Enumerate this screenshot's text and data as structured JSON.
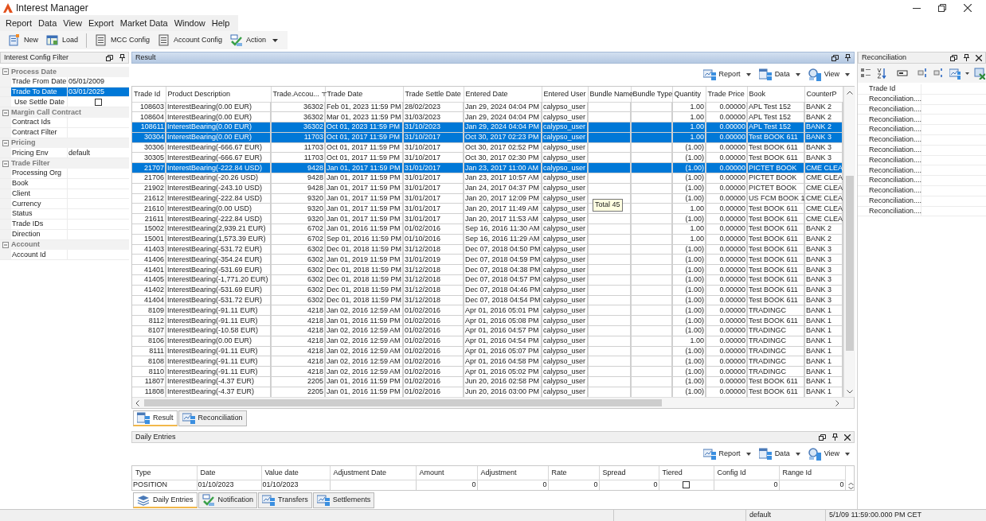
{
  "window": {
    "title": "Interest Manager"
  },
  "menu": [
    "Report",
    "Data",
    "View",
    "Export",
    "Market Data",
    "Window",
    "Help"
  ],
  "toolbar": [
    {
      "label": "New",
      "kind": "button"
    },
    {
      "label": "Load",
      "kind": "button"
    },
    {
      "label": "MCC Config",
      "kind": "button"
    },
    {
      "label": "Account Config",
      "kind": "button"
    },
    {
      "label": "Action",
      "kind": "dropdown"
    }
  ],
  "filter_panel": {
    "title": "Interest Config Filter",
    "groups": [
      {
        "title": "Process Date",
        "expanded": true,
        "fields": [
          {
            "label": "Trade From Date",
            "value": "05/01/2009",
            "kind": "text",
            "selected": false
          },
          {
            "label": "Trade To Date",
            "value": "03/01/2025",
            "kind": "text",
            "selected": true
          },
          {
            "label": "Use Settle Date",
            "kind": "checkbox",
            "checked": false,
            "selected": false
          }
        ]
      },
      {
        "title": "Margin Call Contract",
        "expanded": true,
        "fields": [
          {
            "label": "Contract Ids",
            "kind": "text",
            "selected": false
          },
          {
            "label": "Contract Filter",
            "kind": "text",
            "selected": false
          }
        ]
      },
      {
        "title": "Pricing",
        "expanded": true,
        "fields": [
          {
            "label": "Pricing Env",
            "value": "default",
            "kind": "text",
            "selected": false
          }
        ]
      },
      {
        "title": "Trade Filter",
        "expanded": true,
        "fields": [
          {
            "label": "Processing Org",
            "kind": "text",
            "selected": false
          },
          {
            "label": "Book",
            "kind": "text",
            "selected": false
          },
          {
            "label": "Client",
            "kind": "text",
            "selected": false
          },
          {
            "label": "Currency",
            "kind": "text",
            "selected": false
          },
          {
            "label": "Status",
            "kind": "text",
            "selected": false
          },
          {
            "label": "Trade IDs",
            "kind": "text",
            "selected": false
          },
          {
            "label": "Direction",
            "kind": "text",
            "selected": false
          }
        ]
      },
      {
        "title": "Account",
        "expanded": true,
        "fields": [
          {
            "label": "Account Id",
            "kind": "text",
            "selected": false
          }
        ]
      }
    ]
  },
  "result_panel": {
    "title": "Result",
    "actions": [
      "Report",
      "Data",
      "View"
    ],
    "table": {
      "columns": [
        {
          "label": "Trade Id",
          "kind": "number"
        },
        {
          "label": "Product Description",
          "kind": "text"
        },
        {
          "label": "Trade.Accou...",
          "kind": "number",
          "sorted": true
        },
        {
          "label": "Trade Date",
          "kind": "text"
        },
        {
          "label": "Trade Settle Date",
          "kind": "text"
        },
        {
          "label": "Entered Date",
          "kind": "text"
        },
        {
          "label": "Entered User",
          "kind": "text"
        },
        {
          "label": "Bundle Name",
          "kind": "text"
        },
        {
          "label": "Bundle Type",
          "kind": "text"
        },
        {
          "label": "Quantity",
          "kind": "number"
        },
        {
          "label": "Trade Price",
          "kind": "number"
        },
        {
          "label": "Book",
          "kind": "text"
        },
        {
          "label": "CounterP",
          "kind": "text"
        }
      ],
      "rows": [
        {
          "cells": [
            "108603",
            "InterestBearing(0.00 EUR)",
            "36302",
            "Feb 01, 2023 11:59 PM",
            "28/02/2023",
            "Jan 29, 2024 04:04 PM",
            "calypso_user",
            "",
            "",
            "1.00",
            "0.00000",
            "APL Test 152",
            "BANK 2"
          ],
          "selected": false
        },
        {
          "cells": [
            "108604",
            "InterestBearing(0.00 EUR)",
            "36302",
            "Mar 01, 2023 11:59 PM",
            "31/03/2023",
            "Jan 29, 2024 04:04 PM",
            "calypso_user",
            "",
            "",
            "1.00",
            "0.00000",
            "APL Test 152",
            "BANK 2"
          ],
          "selected": false
        },
        {
          "cells": [
            "108611",
            "InterestBearing(0.00 EUR)",
            "36302",
            "Oct 01, 2023 11:59 PM",
            "31/10/2023",
            "Jan 29, 2024 04:04 PM",
            "calypso_user",
            "",
            "",
            "1.00",
            "0.00000",
            "APL Test 152",
            "BANK 2"
          ],
          "selected": true
        },
        {
          "cells": [
            "30304",
            "InterestBearing(0.00 EUR)",
            "11703",
            "Oct 01, 2017 11:59 PM",
            "31/10/2017",
            "Oct 30, 2017 02:23 PM",
            "calypso_user",
            "",
            "",
            "1.00",
            "0.00000",
            "Test BOOK 611",
            "BANK 3"
          ],
          "selected": true
        },
        {
          "cells": [
            "30306",
            "InterestBearing(-666.67 EUR)",
            "11703",
            "Oct 01, 2017 11:59 PM",
            "31/10/2017",
            "Oct 30, 2017 02:52 PM",
            "calypso_user",
            "",
            "",
            "(1.00)",
            "0.00000",
            "Test BOOK 611",
            "BANK 3"
          ],
          "selected": false
        },
        {
          "cells": [
            "30305",
            "InterestBearing(-666.67 EUR)",
            "11703",
            "Oct 01, 2017 11:59 PM",
            "31/10/2017",
            "Oct 30, 2017 02:30 PM",
            "calypso_user",
            "",
            "",
            "(1.00)",
            "0.00000",
            "Test BOOK 611",
            "BANK 3"
          ],
          "selected": false
        },
        {
          "cells": [
            "21707",
            "InterestBearing(-222.84 USD)",
            "9428",
            "Jan 01, 2017 11:59 PM",
            "31/01/2017",
            "Jan 23, 2017 11:00 AM",
            "calypso_user",
            "",
            "",
            "(1.00)",
            "0.00000",
            "PICTET BOOK",
            "CME CLEA"
          ],
          "selected": true
        },
        {
          "cells": [
            "21706",
            "InterestBearing(-20.26 USD)",
            "9428",
            "Jan 01, 2017 11:59 PM",
            "31/01/2017",
            "Jan 23, 2017 10:57 AM",
            "calypso_user",
            "",
            "",
            "(1.00)",
            "0.00000",
            "PICTET BOOK",
            "CME CLEA"
          ],
          "selected": false
        },
        {
          "cells": [
            "21902",
            "InterestBearing(-243.10 USD)",
            "9428",
            "Jan 01, 2017 11:59 PM",
            "31/01/2017",
            "Jan 24, 2017 04:37 PM",
            "calypso_user",
            "",
            "",
            "(1.00)",
            "0.00000",
            "PICTET BOOK",
            "CME CLEA"
          ],
          "selected": false
        },
        {
          "cells": [
            "21612",
            "InterestBearing(-222.84 USD)",
            "9320",
            "Jan 01, 2017 11:59 PM",
            "31/01/2017",
            "Jan 20, 2017 12:09 PM",
            "calypso_user",
            "",
            "",
            "(1.00)",
            "0.00000",
            "US FCM BOOK 1",
            "CME CLEA"
          ],
          "selected": false
        },
        {
          "cells": [
            "21610",
            "InterestBearing(0.00 USD)",
            "9320",
            "Jan 01, 2017 11:59 PM",
            "31/01/2017",
            "Jan 20, 2017 11:49 AM",
            "calypso_user",
            "",
            "",
            "1.00",
            "0.00000",
            "Test BOOK 611",
            "CME CLEA"
          ],
          "selected": false
        },
        {
          "cells": [
            "21611",
            "InterestBearing(-222.84 USD)",
            "9320",
            "Jan 01, 2017 11:59 PM",
            "31/01/2017",
            "Jan 20, 2017 11:53 AM",
            "calypso_user",
            "",
            "",
            "(1.00)",
            "0.00000",
            "Test BOOK 611",
            "CME CLEA"
          ],
          "selected": false
        },
        {
          "cells": [
            "15002",
            "InterestBearing(2,939.21 EUR)",
            "6702",
            "Jan 01, 2016 11:59 PM",
            "01/02/2016",
            "Sep 16, 2016 11:30 AM",
            "calypso_user",
            "",
            "",
            "1.00",
            "0.00000",
            "Test BOOK 611",
            "BANK 2"
          ],
          "selected": false
        },
        {
          "cells": [
            "15001",
            "InterestBearing(1,573.39 EUR)",
            "6702",
            "Sep 01, 2016 11:59 PM",
            "01/10/2016",
            "Sep 16, 2016 11:29 AM",
            "calypso_user",
            "",
            "",
            "1.00",
            "0.00000",
            "Test BOOK 611",
            "BANK 2"
          ],
          "selected": false
        },
        {
          "cells": [
            "41403",
            "InterestBearing(-531.72 EUR)",
            "6302",
            "Dec 01, 2018 11:59 PM",
            "31/12/2018",
            "Dec 07, 2018 04:50 PM",
            "calypso_user",
            "",
            "",
            "(1.00)",
            "0.00000",
            "Test BOOK 611",
            "BANK 3"
          ],
          "selected": false
        },
        {
          "cells": [
            "41406",
            "InterestBearing(-354.24 EUR)",
            "6302",
            "Jan 01, 2019 11:59 PM",
            "31/01/2019",
            "Dec 07, 2018 04:59 PM",
            "calypso_user",
            "",
            "",
            "(1.00)",
            "0.00000",
            "Test BOOK 611",
            "BANK 3"
          ],
          "selected": false
        },
        {
          "cells": [
            "41401",
            "InterestBearing(-531.69 EUR)",
            "6302",
            "Dec 01, 2018 11:59 PM",
            "31/12/2018",
            "Dec 07, 2018 04:38 PM",
            "calypso_user",
            "",
            "",
            "(1.00)",
            "0.00000",
            "Test BOOK 611",
            "BANK 3"
          ],
          "selected": false
        },
        {
          "cells": [
            "41405",
            "InterestBearing(-1,771.20 EUR)",
            "6302",
            "Dec 01, 2018 11:59 PM",
            "31/12/2018",
            "Dec 07, 2018 04:57 PM",
            "calypso_user",
            "",
            "",
            "(1.00)",
            "0.00000",
            "Test BOOK 611",
            "BANK 3"
          ],
          "selected": false
        },
        {
          "cells": [
            "41402",
            "InterestBearing(-531.69 EUR)",
            "6302",
            "Dec 01, 2018 11:59 PM",
            "31/12/2018",
            "Dec 07, 2018 04:46 PM",
            "calypso_user",
            "",
            "",
            "(1.00)",
            "0.00000",
            "Test BOOK 611",
            "BANK 3"
          ],
          "selected": false
        },
        {
          "cells": [
            "41404",
            "InterestBearing(-531.72 EUR)",
            "6302",
            "Dec 01, 2018 11:59 PM",
            "31/12/2018",
            "Dec 07, 2018 04:54 PM",
            "calypso_user",
            "",
            "",
            "(1.00)",
            "0.00000",
            "Test BOOK 611",
            "BANK 3"
          ],
          "selected": false
        },
        {
          "cells": [
            "8109",
            "InterestBearing(-91.11 EUR)",
            "4218",
            "Jan 02, 2016 12:59 AM",
            "01/02/2016",
            "Apr 01, 2016 05:01 PM",
            "calypso_user",
            "",
            "",
            "(1.00)",
            "0.00000",
            "TRADINGC",
            "BANK 1"
          ],
          "selected": false
        },
        {
          "cells": [
            "8112",
            "InterestBearing(-91.11 EUR)",
            "4218",
            "Jan 01, 2016 11:59 PM",
            "01/02/2016",
            "Apr 01, 2016 05:08 PM",
            "calypso_user",
            "",
            "",
            "(1.00)",
            "0.00000",
            "Test BOOK 611",
            "BANK 1"
          ],
          "selected": false
        },
        {
          "cells": [
            "8107",
            "InterestBearing(-10.58 EUR)",
            "4218",
            "Jan 02, 2016 12:59 AM",
            "01/02/2016",
            "Apr 01, 2016 04:57 PM",
            "calypso_user",
            "",
            "",
            "(1.00)",
            "0.00000",
            "TRADINGC",
            "BANK 1"
          ],
          "selected": false
        },
        {
          "cells": [
            "8106",
            "InterestBearing(0.00 EUR)",
            "4218",
            "Jan 02, 2016 12:59 AM",
            "01/02/2016",
            "Apr 01, 2016 04:54 PM",
            "calypso_user",
            "",
            "",
            "1.00",
            "0.00000",
            "TRADINGC",
            "BANK 1"
          ],
          "selected": false
        },
        {
          "cells": [
            "8111",
            "InterestBearing(-91.11 EUR)",
            "4218",
            "Jan 02, 2016 12:59 AM",
            "01/02/2016",
            "Apr 01, 2016 05:07 PM",
            "calypso_user",
            "",
            "",
            "(1.00)",
            "0.00000",
            "TRADINGC",
            "BANK 1"
          ],
          "selected": false
        },
        {
          "cells": [
            "8108",
            "InterestBearing(-91.11 EUR)",
            "4218",
            "Jan 02, 2016 12:59 AM",
            "01/02/2016",
            "Apr 01, 2016 04:58 PM",
            "calypso_user",
            "",
            "",
            "(1.00)",
            "0.00000",
            "TRADINGC",
            "BANK 1"
          ],
          "selected": false
        },
        {
          "cells": [
            "8110",
            "InterestBearing(-91.11 EUR)",
            "4218",
            "Jan 02, 2016 12:59 AM",
            "01/02/2016",
            "Apr 01, 2016 05:02 PM",
            "calypso_user",
            "",
            "",
            "(1.00)",
            "0.00000",
            "TRADINGC",
            "BANK 1"
          ],
          "selected": false
        },
        {
          "cells": [
            "11807",
            "InterestBearing(-4.37 EUR)",
            "2205",
            "Jan 01, 2016 11:59 PM",
            "01/02/2016",
            "Jun 20, 2016 02:58 PM",
            "calypso_user",
            "",
            "",
            "(1.00)",
            "0.00000",
            "Test BOOK 611",
            "BANK 1"
          ],
          "selected": false
        },
        {
          "cells": [
            "11808",
            "InterestBearing(-4.37 EUR)",
            "2205",
            "Jan 01, 2016 11:59 PM",
            "01/02/2016",
            "Jun 20, 2016 03:00 PM",
            "calypso_user",
            "",
            "",
            "(1.00)",
            "0.00000",
            "Test BOOK 611",
            "BANK 1"
          ],
          "selected": false
        }
      ]
    },
    "tooltip": "Total 45",
    "tabs": [
      {
        "label": "Result",
        "selected": true
      },
      {
        "label": "Reconciliation",
        "selected": false
      }
    ]
  },
  "reconciliation_panel": {
    "title": "Reconciliation",
    "rows": [
      "Trade Id",
      "Reconciliation....",
      "Reconciliation....",
      "Reconciliation....",
      "Reconciliation....",
      "Reconciliation....",
      "Reconciliation....",
      "Reconciliation....",
      "Reconciliation....",
      "Reconciliation....",
      "Reconciliation....",
      "Reconciliation....",
      "Reconciliation...."
    ]
  },
  "daily_entries": {
    "title": "Daily Entries",
    "actions": [
      "Report",
      "Data",
      "View"
    ],
    "columns": [
      {
        "label": "Type",
        "kind": "text"
      },
      {
        "label": "Date",
        "kind": "text"
      },
      {
        "label": "Value date",
        "kind": "text"
      },
      {
        "label": "Adjustment Date",
        "kind": "text"
      },
      {
        "label": "Amount",
        "kind": "number"
      },
      {
        "label": "Adjustment",
        "kind": "number"
      },
      {
        "label": "Rate",
        "kind": "number"
      },
      {
        "label": "Spread",
        "kind": "number"
      },
      {
        "label": "Tiered",
        "kind": "checkbox"
      },
      {
        "label": "Config Id",
        "kind": "number"
      },
      {
        "label": "Range Id",
        "kind": "number"
      }
    ],
    "rows": [
      {
        "cells": [
          "POSITION",
          "01/10/2023",
          "01/10/2023",
          "",
          "0",
          "0",
          "0",
          "0",
          false,
          "0",
          "0"
        ]
      }
    ],
    "tabs": [
      {
        "label": "Daily Entries",
        "selected": true
      },
      {
        "label": "Notification",
        "selected": false
      },
      {
        "label": "Transfers",
        "selected": false
      },
      {
        "label": "Settlements",
        "selected": false
      }
    ]
  },
  "status_bar": [
    "default",
    "5/1/09 11:59:00.000 PM CET"
  ]
}
